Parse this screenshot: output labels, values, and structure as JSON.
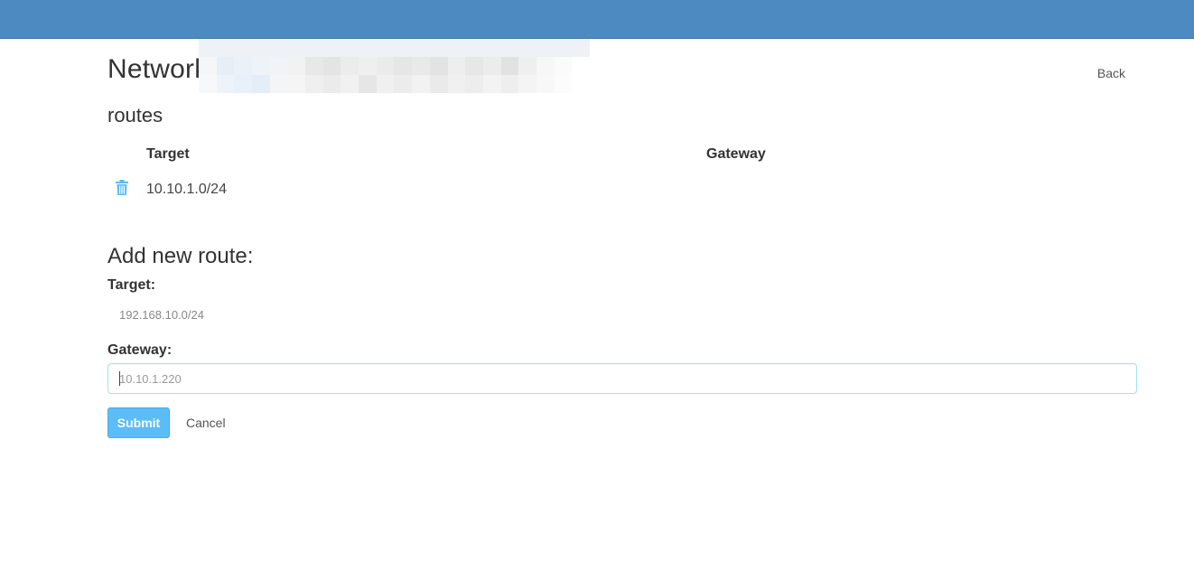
{
  "header": {
    "title": "Network",
    "back_label": "Back",
    "bar_color": "#4e8ac2"
  },
  "routes": {
    "section_title": "routes",
    "columns": [
      "Target",
      "Gateway"
    ],
    "rows": [
      {
        "target": "10.10.1.0/24",
        "gateway": "",
        "delete_icon": "trash-icon"
      }
    ]
  },
  "add_route": {
    "title": "Add new route:",
    "target_label": "Target:",
    "target_placeholder": "192.168.10.0/24",
    "gateway_label": "Gateway:",
    "gateway_placeholder": "10.10.1.220",
    "submit_label": "Submit",
    "cancel_label": "Cancel"
  },
  "colors": {
    "accent": "#5bbcf7",
    "icon": "#5bbcf7",
    "input_border": "#9fe3f5"
  }
}
